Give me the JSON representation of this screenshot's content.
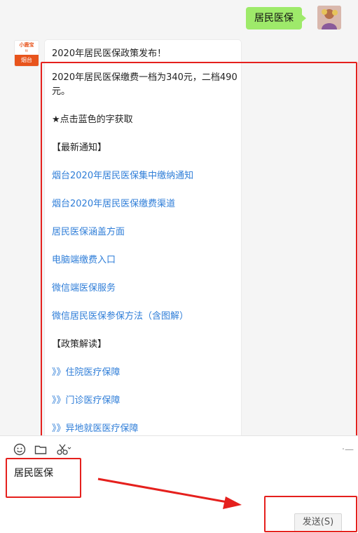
{
  "outgoing_message": "居民医保",
  "bot_avatar": {
    "line1": "小鹿宝",
    "line2": "tt",
    "city": "烟台"
  },
  "card": {
    "title": "2020年居民医保政策发布！",
    "paragraphs": [
      {
        "text": "2020年居民医保缴费一档为340元，二档490元。",
        "link": false
      },
      {
        "text": "★点击蓝色的字获取",
        "link": false
      },
      {
        "text": "【最新通知】",
        "link": false
      },
      {
        "text": "烟台2020年居民医保集中缴纳通知",
        "link": true
      },
      {
        "text": "烟台2020年居民医保缴费渠道",
        "link": true
      },
      {
        "text": "居民医保涵盖方面",
        "link": true
      },
      {
        "text": "电脑端缴费入口",
        "link": true
      },
      {
        "text": "微信端医保服务",
        "link": true
      },
      {
        "text": "微信居民医保参保方法（含图解）",
        "link": true
      },
      {
        "text": "【政策解读】",
        "link": false
      },
      {
        "text": "》》住院医疗保障",
        "link": true
      },
      {
        "text": "》》门诊医疗保障",
        "link": true
      },
      {
        "text": "》》异地就医医疗保障",
        "link": true
      }
    ]
  },
  "toolbar": {
    "icons": [
      "emoji-icon",
      "folder-icon",
      "scissors-icon"
    ],
    "more": "·—"
  },
  "input": {
    "draft": "居民医保"
  },
  "send_button": "发送(S)",
  "colors": {
    "link": "#2f7ed8",
    "outgoing_bubble": "#9eea6a",
    "annotation": "#e5201d"
  }
}
